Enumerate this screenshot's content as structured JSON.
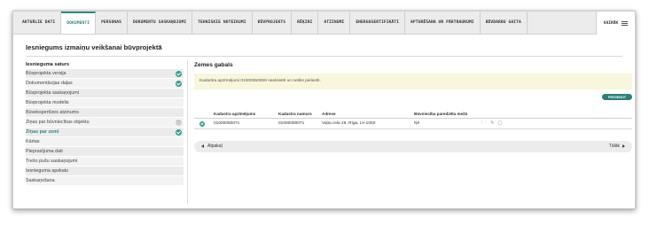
{
  "tabs": [
    {
      "label": "AKTUĀLIE DATI",
      "active": false
    },
    {
      "label": "DOKUMENTI",
      "active": true
    },
    {
      "label": "PERSONAS",
      "active": false
    },
    {
      "label": "DOKUMENTU SASKAŅOJUMI",
      "active": false
    },
    {
      "label": "TEHNISKIE NOTEIKUMI",
      "active": false
    },
    {
      "label": "BŪVPROJEKTS",
      "active": false
    },
    {
      "label": "RĒĶINI",
      "active": false
    },
    {
      "label": "ATZINUMI",
      "active": false
    },
    {
      "label": "ENERGOSERTIFIKĀTI",
      "active": false
    },
    {
      "label": "APTURĒŠANA UN PĀRTRAUKUMI",
      "active": false
    },
    {
      "label": "BŪVDARBU GAITA",
      "active": false
    }
  ],
  "more_label": "VAIRĀK",
  "page_title": "Iesniegums izmaiņu veikšanai būvprojektā",
  "sidebar": {
    "heading": "Iesnieguma saturs",
    "items": [
      {
        "label": "Būvprojekta versija",
        "status": "check",
        "active": false
      },
      {
        "label": "Dokumentācijas daļas",
        "status": "check",
        "active": false
      },
      {
        "label": "Būvprojekta saskaņojumi",
        "status": "",
        "active": false
      },
      {
        "label": "Būvprojekta modelis",
        "status": "",
        "active": false
      },
      {
        "label": "Būvekspertīzes atzinums",
        "status": "",
        "active": false
      },
      {
        "label": "Ziņas par būvniecības objektu",
        "status": "dots",
        "active": false
      },
      {
        "label": "Ziņas par zemi",
        "status": "check",
        "active": true
      },
      {
        "label": "Kārtas",
        "status": "",
        "active": false
      },
      {
        "label": "Pieprasījuma dati",
        "status": "",
        "active": false
      },
      {
        "label": "Trešo pušu saskaņojumi",
        "status": "",
        "active": false
      },
      {
        "label": "Iesnieguma apskats",
        "status": "",
        "active": false
      },
      {
        "label": "Saskaņošana",
        "status": "",
        "active": false
      }
    ]
  },
  "main": {
    "section_title": "Zemes gabals",
    "warning": "Kadastra apzīmējumi 01000050069 neeksistē un netiks pielasīti.",
    "add_button": "PIEVIENOT",
    "columns": [
      "Kadastra apzīmējums",
      "Kadastra numurs",
      "Adrese",
      "Būvniecība paredzēta mežā"
    ],
    "rows": [
      {
        "apzimejums": "01000050071",
        "numurs": "01000050071",
        "adrese": "Vaļņu iela 26, Rīga, LV-1050",
        "meza": "Nē"
      }
    ]
  },
  "nav": {
    "back": "Atpakaļ",
    "next": "Tālāk"
  },
  "colors": {
    "accent": "#2f8a82",
    "warning_bg": "#f8f6dc"
  }
}
